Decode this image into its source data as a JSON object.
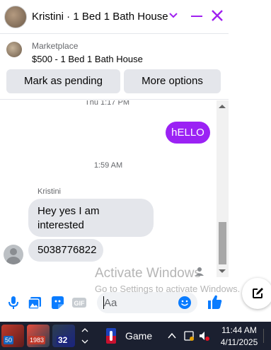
{
  "header": {
    "title": "Kristini · 1 Bed 1 Bath House"
  },
  "marketplace": {
    "label": "Marketplace",
    "item": "$500 - 1 Bed 1 Bath House",
    "mark_pending_label": "Mark as pending",
    "more_options_label": "More options"
  },
  "conversation": {
    "top_timestamp": "Thu 1:17 PM",
    "outgoing_message": "hELLO",
    "middle_timestamp": "1:59 AM",
    "sender_name": "Kristini",
    "incoming_messages": [
      "Hey yes I am interested",
      "5038776822"
    ]
  },
  "composer": {
    "placeholder": "Aa",
    "gif_label": "GIF"
  },
  "watermark": {
    "line1": "Activate Windows",
    "line2": "Go to Settings to activate Windows."
  },
  "taskbar": {
    "badges": [
      "50",
      "1983",
      "32"
    ],
    "game_label": "Game",
    "time": "11:44 AM",
    "date": "4/11/2025"
  },
  "colors": {
    "accent": "#9b22f4",
    "bubble_incoming": "#e4e6eb",
    "taskbar": "#1b2030"
  }
}
